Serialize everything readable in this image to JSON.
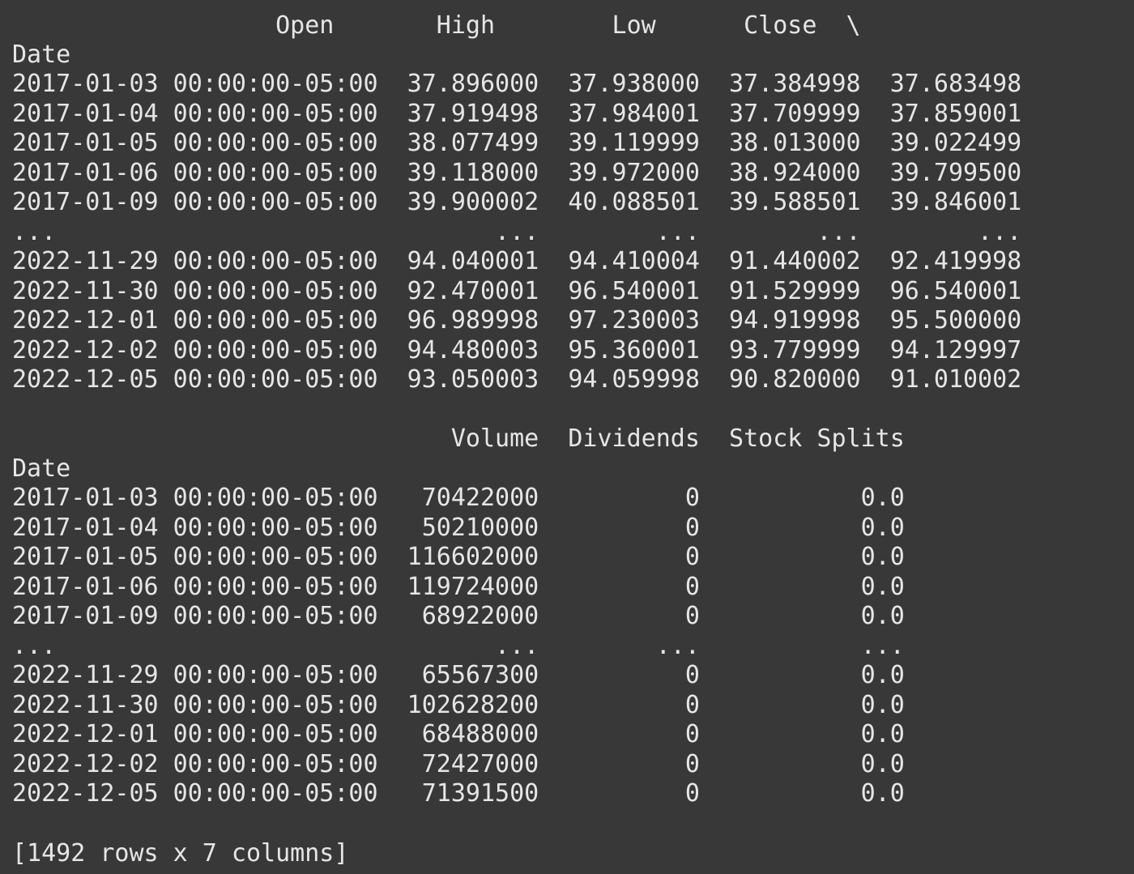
{
  "terminal": {
    "lines": [
      "                  Open       High        Low      Close  \\",
      "Date",
      "2017-01-03 00:00:00-05:00  37.896000  37.938000  37.384998  37.683498",
      "2017-01-04 00:00:00-05:00  37.919498  37.984001  37.709999  37.859001",
      "2017-01-05 00:00:00-05:00  38.077499  39.119999  38.013000  39.022499",
      "2017-01-06 00:00:00-05:00  39.118000  39.972000  38.924000  39.799500",
      "2017-01-09 00:00:00-05:00  39.900002  40.088501  39.588501  39.846001",
      "...                              ...        ...        ...        ...",
      "2022-11-29 00:00:00-05:00  94.040001  94.410004  91.440002  92.419998",
      "2022-11-30 00:00:00-05:00  92.470001  96.540001  91.529999  96.540001",
      "2022-12-01 00:00:00-05:00  96.989998  97.230003  94.919998  95.500000",
      "2022-12-02 00:00:00-05:00  94.480003  95.360001  93.779999  94.129997",
      "2022-12-05 00:00:00-05:00  93.050003  94.059998  90.820000  91.010002",
      "",
      "                              Volume  Dividends  Stock Splits",
      "Date",
      "2017-01-03 00:00:00-05:00   70422000          0           0.0",
      "2017-01-04 00:00:00-05:00   50210000          0           0.0",
      "2017-01-05 00:00:00-05:00  116602000          0           0.0",
      "2017-01-06 00:00:00-05:00  119724000          0           0.0",
      "2017-01-09 00:00:00-05:00   68922000          0           0.0",
      "...                              ...        ...           ...",
      "2022-11-29 00:00:00-05:00   65567300          0           0.0",
      "2022-11-30 00:00:00-05:00  102628200          0           0.0",
      "2022-12-01 00:00:00-05:00   68488000          0           0.0",
      "2022-12-02 00:00:00-05:00   72427000          0           0.0",
      "2022-12-05 00:00:00-05:00   71391500          0           0.0",
      "",
      "[1492 rows x 7 columns]"
    ]
  }
}
